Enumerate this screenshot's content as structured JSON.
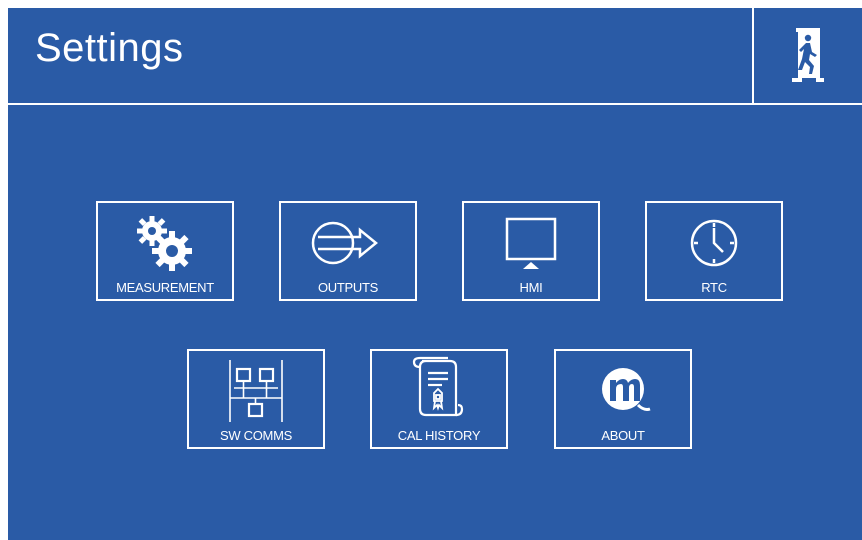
{
  "header": {
    "title": "Settings",
    "exit_icon": "emergency-exit-icon"
  },
  "colors": {
    "background": "#2a5ba6",
    "foreground": "#ffffff"
  },
  "tiles": [
    {
      "label": "MEASUREMENT",
      "icon": "gears-icon"
    },
    {
      "label": "OUTPUTS",
      "icon": "output-arrow-icon"
    },
    {
      "label": "HMI",
      "icon": "monitor-icon"
    },
    {
      "label": "RTC",
      "icon": "clock-icon"
    },
    {
      "label": "SW COMMS",
      "icon": "network-icon"
    },
    {
      "label": "CAL HISTORY",
      "icon": "certificate-scroll-icon"
    },
    {
      "label": "ABOUT",
      "icon": "m-logo-icon"
    }
  ]
}
